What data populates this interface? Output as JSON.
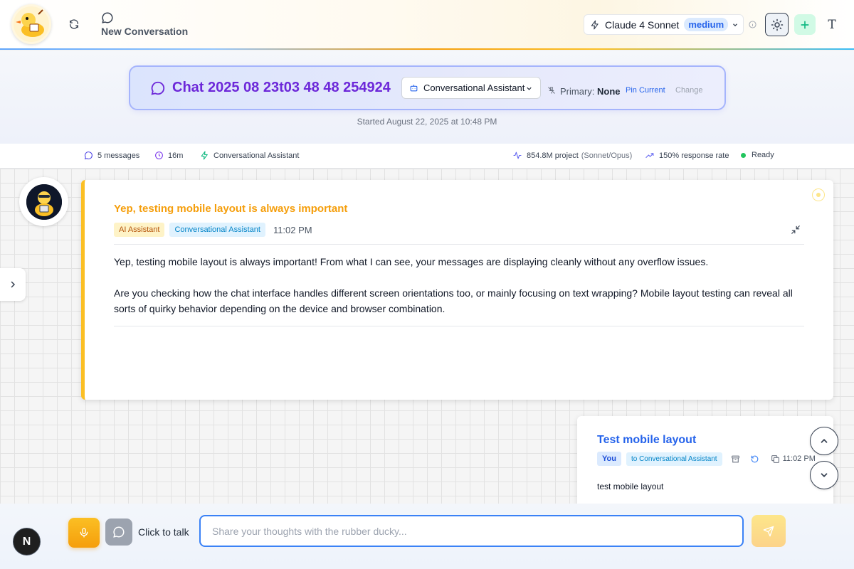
{
  "header": {
    "new_conversation_label": "New Conversation",
    "model_name": "Claude 4 Sonnet",
    "model_effort": "medium",
    "text_toggle_glyph": "T"
  },
  "chat": {
    "title": "Chat 2025 08 23t03 48 48 254924",
    "assistant": "Conversational Assistant",
    "primary_label": "Primary:",
    "primary_value": "None",
    "pin_current": "Pin Current",
    "change": "Change",
    "started": "Started August 22, 2025 at 10:48 PM"
  },
  "stats": {
    "messages": "5 messages",
    "duration": "16m",
    "assistant": "Conversational Assistant",
    "project": "854.8M project",
    "project_models": "(Sonnet/Opus)",
    "response_rate": "150% response rate",
    "status": "Ready"
  },
  "messages": [
    {
      "role": "assistant",
      "heading": "Yep, testing mobile layout is always important",
      "role_tag": "AI Assistant",
      "assistant_tag": "Conversational Assistant",
      "time": "11:02 PM",
      "paragraphs": [
        "Yep, testing mobile layout is always important! From what I can see, your messages are displaying cleanly without any overflow issues.",
        "Are you checking how the chat interface handles different screen orientations too, or mainly focusing on text wrapping? Mobile layout testing can reveal all sorts of quirky behavior depending on the device and browser combination."
      ]
    },
    {
      "role": "user",
      "heading": "Test mobile layout",
      "role_tag": "You",
      "to_tag": "to Conversational Assistant",
      "time": "11:02 PM",
      "body": "test mobile layout"
    }
  ],
  "input": {
    "click_to_talk": "Click to talk",
    "placeholder": "Share your thoughts with the rubber ducky...",
    "value": ""
  },
  "framework_badge": "N",
  "icons": {
    "refresh": "refresh-icon",
    "new_chat": "chat-bubble-icon",
    "model": "lightning-icon",
    "theme": "sun-icon",
    "add": "plus-icon",
    "sidebar_toggle": "chevron-right-icon",
    "scroll_up": "chevron-up-icon",
    "scroll_down": "chevron-down-icon",
    "mic": "microphone-icon",
    "send": "send-icon"
  },
  "colors": {
    "accent_purple": "#6d28d9",
    "assistant_accent": "#f59e0b",
    "user_accent": "#2563eb",
    "ready": "#22c55e",
    "input_border": "#3b82f6"
  }
}
